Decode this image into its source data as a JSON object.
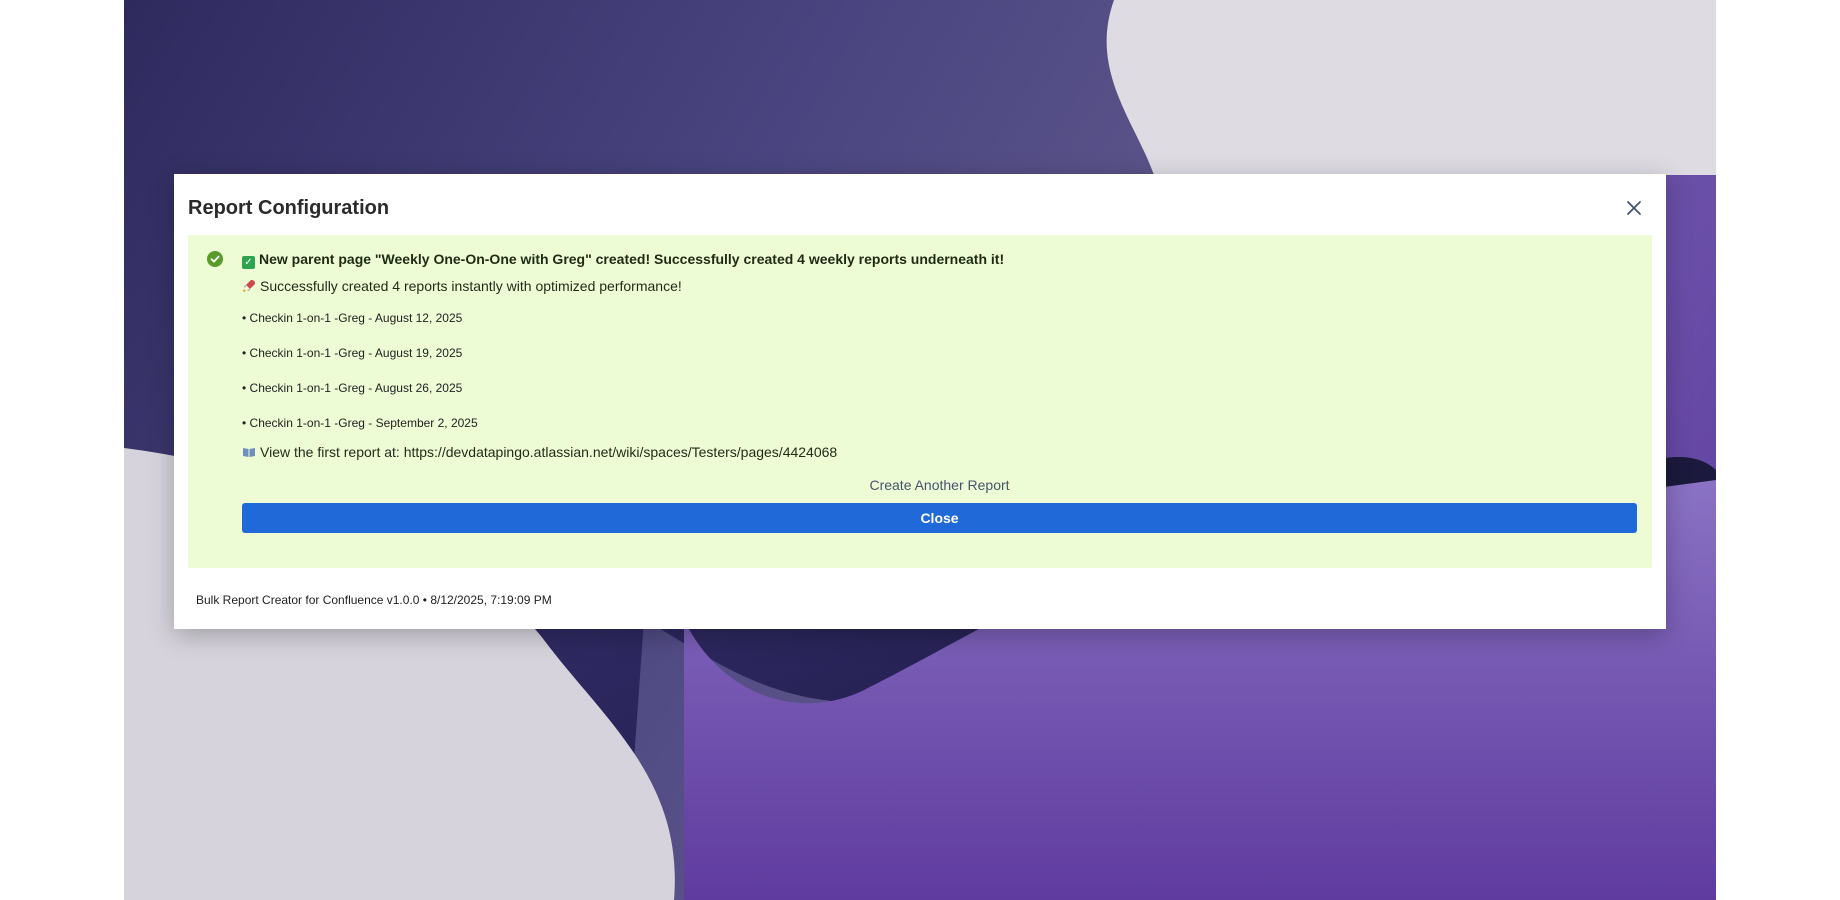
{
  "modal": {
    "title": "Report Configuration",
    "close_icon": "close-icon"
  },
  "success": {
    "status_icon": "check-circle-icon",
    "headline_emoji": "✓",
    "headline": "New parent page \"Weekly One-On-One with Greg\" created! Successfully created 4 weekly reports underneath it!",
    "subline": "Successfully created 4 reports instantly with optimized performance!",
    "reports": [
      "• Checkin 1-on-1 -Greg - August 12, 2025",
      "• Checkin 1-on-1 -Greg - August 19, 2025",
      "• Checkin 1-on-1 -Greg - August 26, 2025",
      "• Checkin 1-on-1 -Greg - September 2, 2025"
    ],
    "view_text": "View the first report at: https://devdatapingo.atlassian.net/wiki/spaces/Testers/pages/4424068",
    "create_another_label": "Create Another Report",
    "close_label": "Close"
  },
  "footer": {
    "text": "Bulk Report Creator for Confluence v1.0.0 • 8/12/2025, 7:19:09 PM"
  },
  "colors": {
    "panel_bg": "#eefcd6",
    "primary": "#1f6ad8",
    "success": "#5b9b2a"
  }
}
